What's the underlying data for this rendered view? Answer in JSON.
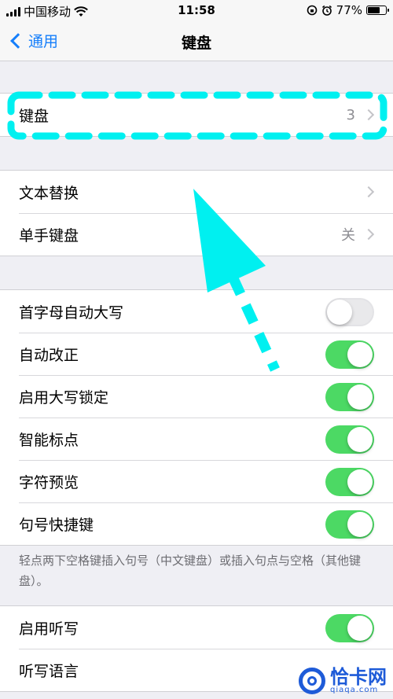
{
  "status_bar": {
    "carrier": "中国移动",
    "time": "11:58",
    "battery_percent": "77%",
    "battery_level": 0.77,
    "icons": [
      "signal-icon",
      "wifi-icon",
      "rotation-lock-icon",
      "alarm-icon",
      "battery-icon"
    ]
  },
  "nav": {
    "back_label": "通用",
    "title": "键盘"
  },
  "keyboards_row": {
    "label": "键盘",
    "value": "3"
  },
  "text_group": {
    "items": [
      {
        "label": "文本替换",
        "value": ""
      },
      {
        "label": "单手键盘",
        "value": "关"
      }
    ]
  },
  "toggle_group": {
    "items": [
      {
        "label": "首字母自动大写",
        "on": false
      },
      {
        "label": "自动改正",
        "on": true
      },
      {
        "label": "启用大写锁定",
        "on": true
      },
      {
        "label": "智能标点",
        "on": true
      },
      {
        "label": "字符预览",
        "on": true
      },
      {
        "label": "句号快捷键",
        "on": true
      }
    ]
  },
  "footer_note": "轻点两下空格键插入句号（中文键盘）或插入句点与空格（其他键盘）。",
  "dictation_group": {
    "items": [
      {
        "label": "启用听写",
        "on": true
      },
      {
        "label": "听写语言",
        "value": ""
      }
    ]
  },
  "watermark": {
    "main": "恰卡网",
    "sub": "qiaqa.com"
  },
  "colors": {
    "accent": "#147efb",
    "toggle_on": "#4cd964",
    "annotation": "#00f0f0",
    "watermark": "#1e5bd8"
  }
}
